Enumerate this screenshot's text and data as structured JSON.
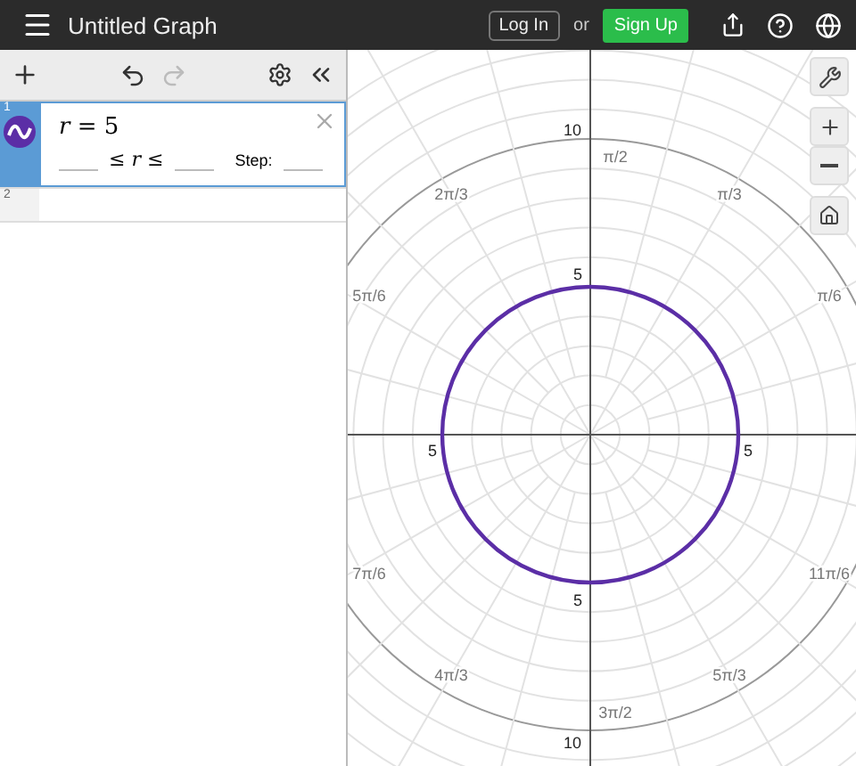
{
  "header": {
    "title": "Untitled Graph",
    "login": "Log In",
    "or": "or",
    "signup": "Sign Up"
  },
  "expressions": [
    {
      "index": "1",
      "kind": "polar",
      "selected": true,
      "formula": "*r* = 5",
      "domain": "≤ *r* ≤",
      "step_label": "Step:"
    },
    {
      "index": "2",
      "kind": "empty",
      "selected": false
    }
  ],
  "graph": {
    "radius_labels": [
      "10",
      "5",
      "5",
      "5",
      "5",
      "10"
    ],
    "angle_labels": [
      "π/6",
      "π/3",
      "π/2",
      "2π/3",
      "5π/6",
      "7π/6",
      "4π/3",
      "3π/2",
      "5π/3",
      "11π/6"
    ]
  }
}
